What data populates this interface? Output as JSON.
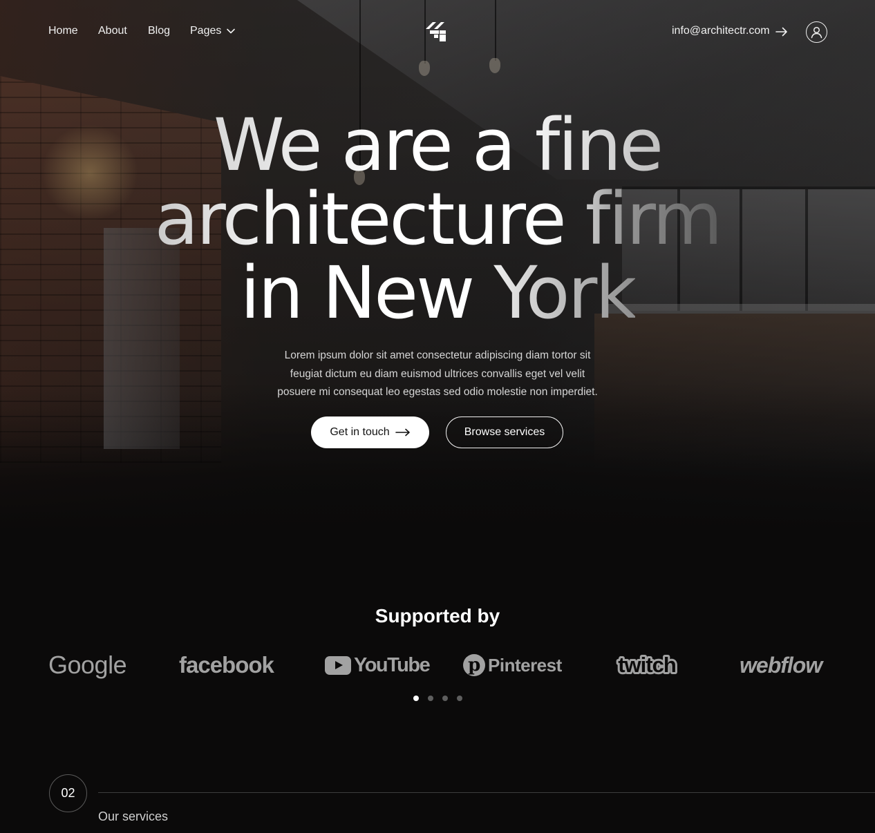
{
  "nav": {
    "links": [
      "Home",
      "About",
      "Blog",
      "Pages"
    ],
    "email": "info@architectr.com"
  },
  "hero": {
    "headline": {
      "line1": "We are a fine",
      "line2": "architecture firm",
      "line3": "in New York"
    },
    "description_lines": [
      "Lorem ipsum dolor sit amet consectetur adipiscing diam tortor sit",
      "feugiat dictum eu diam euismod ultrices convallis eget vel velit",
      "posuere mi consequat leo egestas sed odio molestie non imperdiet."
    ],
    "primary_button": "Get in touch",
    "secondary_button": "Browse services"
  },
  "supported": {
    "title": "Supported by",
    "brands": [
      "Google",
      "facebook",
      "YouTube",
      "Pinterest",
      "twitch",
      "webflow"
    ],
    "carousel": {
      "total": 4,
      "active_index": 0
    }
  },
  "services": {
    "number": "02",
    "label": "Our services"
  },
  "icons": {
    "pages_chevron": "chevron-down-icon",
    "email_arrow": "arrow-right-icon",
    "user": "user-circle-icon",
    "logo": "architectr-logo-icon"
  },
  "colors": {
    "background": "#0b0a0a",
    "text": "#ffffff",
    "brand_gray": "#a2a2a2",
    "dot_inactive": "#5e5e5e"
  }
}
